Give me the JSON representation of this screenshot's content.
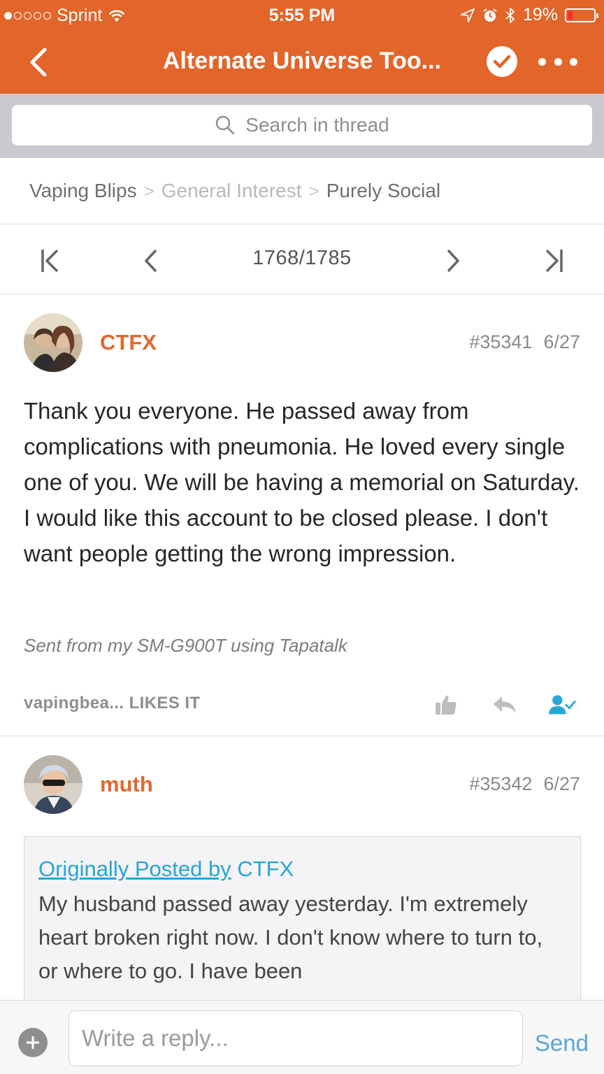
{
  "status_bar": {
    "carrier": "Sprint",
    "time": "5:55 PM",
    "battery_percent": "19%",
    "signal_icon": "signal-dots-icon",
    "wifi_icon": "wifi-icon",
    "location_icon": "location-arrow-icon",
    "alarm_icon": "alarm-icon",
    "bluetooth_icon": "bluetooth-icon"
  },
  "nav": {
    "title": "Alternate Universe Too...",
    "back_icon": "chevron-left-icon",
    "subscribe_icon": "check-circle-icon",
    "more_icon": "more-dots-icon",
    "accent_color": "#e26529"
  },
  "search": {
    "placeholder": "Search in thread"
  },
  "breadcrumb": {
    "items": [
      "Vaping Blips",
      "General Interest",
      "Purely Social"
    ]
  },
  "pager": {
    "count": "1768/1785",
    "current_page": 1768,
    "total_pages": 1785
  },
  "posts": [
    {
      "author": "CTFX",
      "number": "#35341",
      "date": "6/27",
      "body": "Thank you everyone. He passed away from complications with pneumonia. He loved every single one of you. We will be having a memorial on Saturday. I would like this account to be closed please. I don't want people getting the wrong impression.",
      "signature": "Sent from my SM-G900T using Tapatalk",
      "likes": "vapingbea... LIKES IT"
    },
    {
      "author": "muth",
      "number": "#35342",
      "date": "6/27",
      "quote": {
        "prefix": "Originally Posted by",
        "author": "CTFX",
        "text": "My husband passed away yesterday. I'm extremely heart broken right now. I don't know where to turn to, or where to go. I have been"
      }
    }
  ],
  "composer": {
    "placeholder": "Write a reply...",
    "send_label": "Send"
  }
}
